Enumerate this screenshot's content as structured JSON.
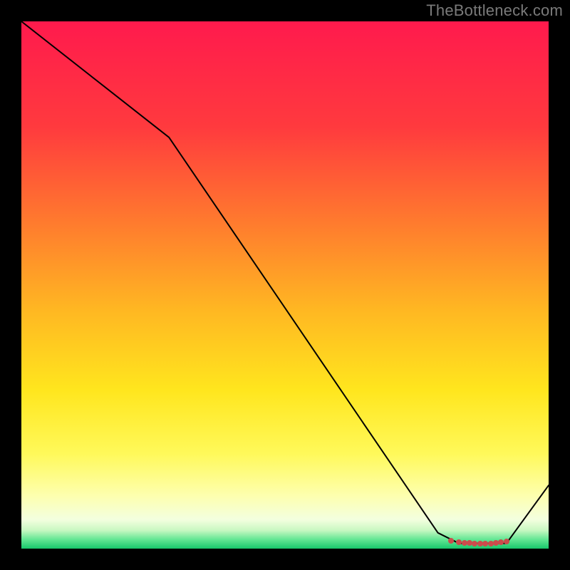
{
  "attribution": "TheBottleneck.com",
  "chart_data": {
    "type": "line",
    "title": "",
    "xlabel": "",
    "ylabel": "",
    "xlim": [
      0,
      100
    ],
    "ylim": [
      0,
      100
    ],
    "grid": false,
    "legend": false,
    "series": [
      {
        "name": "bottleneck-curve",
        "x": [
          0,
          28,
          79,
          83,
          92,
          100
        ],
        "y": [
          100,
          78,
          3,
          1,
          1,
          12
        ],
        "stroke": "#000000",
        "stroke_width": 2
      }
    ],
    "markers": {
      "name": "optimal-cluster",
      "color": "#cc4c4c",
      "radius_px": 4,
      "points": [
        {
          "x": 81.5,
          "y": 1.5
        },
        {
          "x": 83.0,
          "y": 1.2
        },
        {
          "x": 84.0,
          "y": 1.1
        },
        {
          "x": 85.0,
          "y": 1.1
        },
        {
          "x": 86.0,
          "y": 1.0
        },
        {
          "x": 87.0,
          "y": 1.0
        },
        {
          "x": 88.0,
          "y": 1.0
        },
        {
          "x": 89.0,
          "y": 1.0
        },
        {
          "x": 90.0,
          "y": 1.1
        },
        {
          "x": 91.0,
          "y": 1.2
        },
        {
          "x": 92.0,
          "y": 1.4
        }
      ]
    },
    "background_gradient": {
      "description": "vertical gradient, red at top → orange → yellow → pale-yellow → white-green → green at bottom",
      "stops": [
        {
          "offset": 0.0,
          "color": "#ff1a4d"
        },
        {
          "offset": 0.2,
          "color": "#ff3a3e"
        },
        {
          "offset": 0.38,
          "color": "#ff7a2e"
        },
        {
          "offset": 0.55,
          "color": "#ffb822"
        },
        {
          "offset": 0.7,
          "color": "#ffe61e"
        },
        {
          "offset": 0.82,
          "color": "#fff95a"
        },
        {
          "offset": 0.9,
          "color": "#fdffaf"
        },
        {
          "offset": 0.945,
          "color": "#f3ffdf"
        },
        {
          "offset": 0.965,
          "color": "#c9f8c2"
        },
        {
          "offset": 0.982,
          "color": "#66e795"
        },
        {
          "offset": 1.0,
          "color": "#18c76b"
        }
      ]
    }
  }
}
